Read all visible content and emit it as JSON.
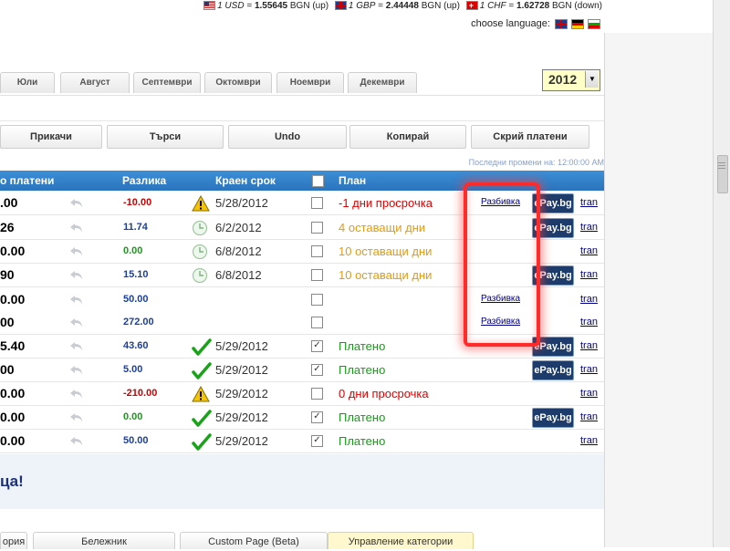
{
  "rates": [
    {
      "flag": "us",
      "unit": "1 USD",
      "value": "1.55645",
      "tail": "BGN (up)"
    },
    {
      "flag": "uk",
      "unit": "1 GBP",
      "value": "2.44448",
      "tail": "BGN (up)"
    },
    {
      "flag": "ch",
      "unit": "1 CHF",
      "value": "1.62728",
      "tail": "BGN (down)"
    }
  ],
  "language": {
    "label": "choose language:"
  },
  "months": [
    "Юли",
    "Август",
    "Септември",
    "Октомври",
    "Ноември",
    "Декември"
  ],
  "year": "2012",
  "actions": {
    "attach": "Прикачи",
    "search": "Търси",
    "undo": "Undo",
    "copy": "Копирай",
    "hide_paid": "Скрий платени"
  },
  "last_change": "Последни промени на: 12:00:00 AM",
  "table": {
    "headers": {
      "paid": "о платени",
      "diff": "Разлика",
      "due": "Краен срок",
      "plan": "План"
    },
    "rows": [
      {
        "amount": ".00",
        "diff": "-10.00",
        "diff_color": "red",
        "status": "warning",
        "date": "5/28/2012",
        "checked": false,
        "plan": "-1 дни просрочка",
        "plan_color": "red",
        "razb": "Разбивка",
        "epay": "ePay.bg",
        "tran": "tran"
      },
      {
        "amount": "26",
        "diff": "11.74",
        "diff_color": "blue",
        "status": "clock",
        "date": "6/2/2012",
        "checked": false,
        "plan": "4 оставащи дни",
        "plan_color": "orange",
        "razb": "",
        "epay": "ePay.bg",
        "tran": "tran"
      },
      {
        "amount": "0.00",
        "diff": "0.00",
        "diff_color": "green",
        "status": "clock",
        "date": "6/8/2012",
        "checked": false,
        "plan": "10 оставащи дни",
        "plan_color": "orange",
        "razb": "",
        "epay": "",
        "tran": "tran"
      },
      {
        "amount": "90",
        "diff": "15.10",
        "diff_color": "blue",
        "status": "clock",
        "date": "6/8/2012",
        "checked": false,
        "plan": "10 оставащи дни",
        "plan_color": "orange",
        "razb": "",
        "epay": "ePay.bg",
        "tran": "tran"
      },
      {
        "amount": "0.00",
        "diff": "50.00",
        "diff_color": "blue",
        "status": "",
        "date": "",
        "checked": false,
        "plan": "",
        "plan_color": "",
        "razb": "Разбивка",
        "epay": "",
        "tran": "tran"
      },
      {
        "amount": "00",
        "diff": "272.00",
        "diff_color": "blue",
        "status": "",
        "date": "",
        "checked": false,
        "plan": "",
        "plan_color": "",
        "razb": "Разбивка",
        "epay": "",
        "tran": "tran"
      },
      {
        "amount": "5.40",
        "diff": "43.60",
        "diff_color": "blue",
        "status": "check",
        "date": "5/29/2012",
        "checked": true,
        "plan": "Платено",
        "plan_color": "green",
        "razb": "",
        "epay": "ePay.bg",
        "tran": "tran"
      },
      {
        "amount": "00",
        "diff": "5.00",
        "diff_color": "blue",
        "status": "check",
        "date": "5/29/2012",
        "checked": true,
        "plan": "Платено",
        "plan_color": "green",
        "razb": "",
        "epay": "ePay.bg",
        "tran": "tran"
      },
      {
        "amount": "0.00",
        "diff": "-210.00",
        "diff_color": "red",
        "status": "warning",
        "date": "5/29/2012",
        "checked": false,
        "plan": "0 дни просрочка",
        "plan_color": "red",
        "razb": "",
        "epay": "",
        "tran": "tran"
      },
      {
        "amount": "0.00",
        "diff": "0.00",
        "diff_color": "green",
        "status": "check",
        "date": "5/29/2012",
        "checked": true,
        "plan": "Платено",
        "plan_color": "green",
        "razb": "",
        "epay": "ePay.bg",
        "tran": "tran"
      },
      {
        "amount": "0.00",
        "diff": "50.00",
        "diff_color": "blue",
        "status": "check",
        "date": "5/29/2012",
        "checked": true,
        "plan": "Платено",
        "plan_color": "green",
        "razb": "",
        "epay": "",
        "tran": "tran"
      }
    ]
  },
  "promo": "ца!",
  "bottom_tabs": [
    {
      "label": "ория",
      "active": false
    },
    {
      "label": "Бележник",
      "active": false
    },
    {
      "label": "Custom Page (Beta)",
      "active": false
    },
    {
      "label": "Управление категории",
      "active": true
    }
  ],
  "colors": {
    "header": "#2a74bd",
    "highlight": "#ff2b2b",
    "epay": "#1d3c6b"
  }
}
